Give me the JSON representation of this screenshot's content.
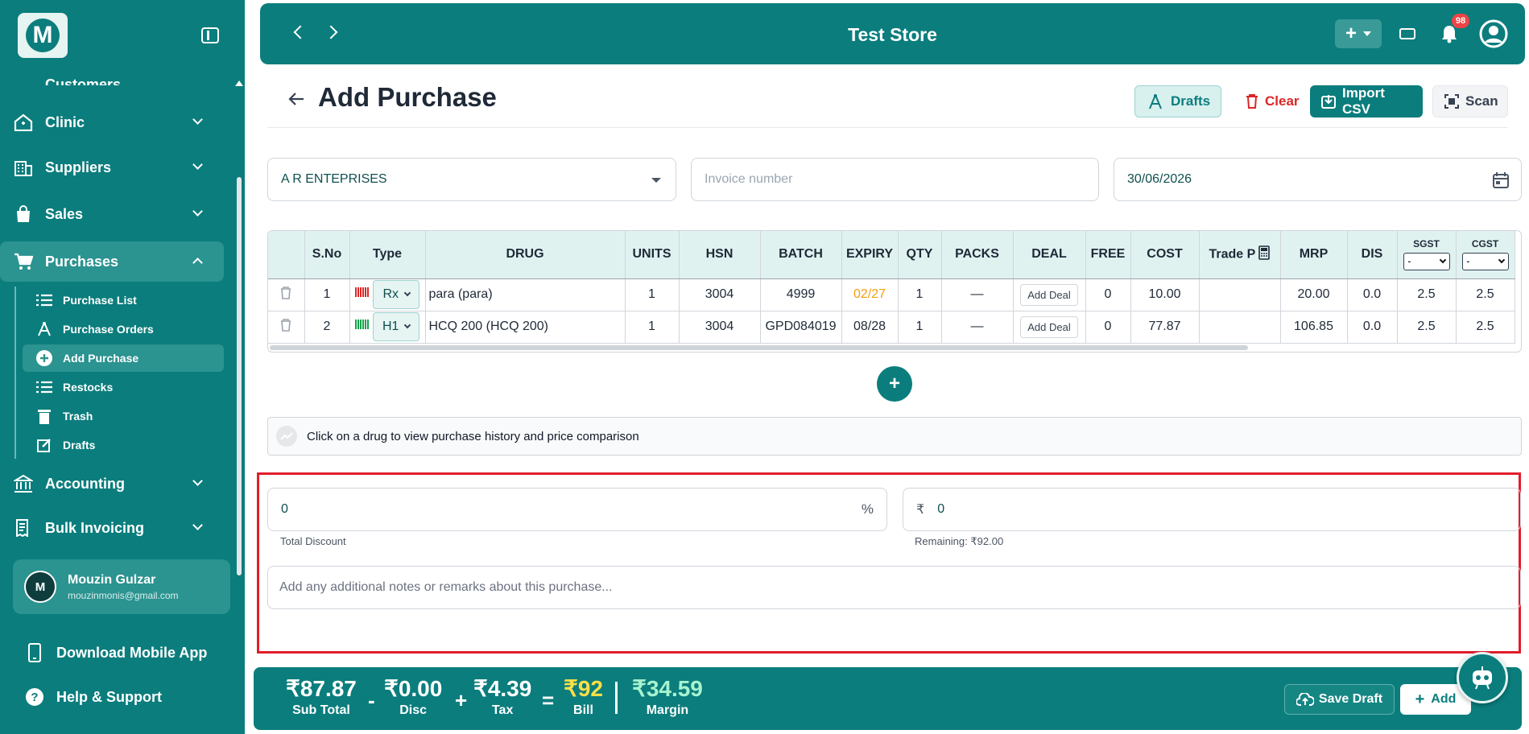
{
  "app": {
    "logo_letter": "M",
    "accent": "#0b7d7d"
  },
  "sidebar": {
    "partial_item": "Customers",
    "items": [
      {
        "label": "Clinic",
        "icon": "clinic-icon"
      },
      {
        "label": "Suppliers",
        "icon": "building-icon"
      },
      {
        "label": "Sales",
        "icon": "bag-icon"
      },
      {
        "label": "Purchases",
        "icon": "cart-icon"
      },
      {
        "label": "Accounting",
        "icon": "bank-icon"
      },
      {
        "label": "Bulk Invoicing",
        "icon": "receipt-icon"
      }
    ],
    "sub_items": [
      {
        "label": "Purchase List",
        "icon": "list-icon"
      },
      {
        "label": "Purchase Orders",
        "icon": "compass-icon"
      },
      {
        "label": "Add Purchase",
        "icon": "plus-circle-icon"
      },
      {
        "label": "Restocks",
        "icon": "list-icon"
      },
      {
        "label": "Trash",
        "icon": "trash-icon"
      },
      {
        "label": "Drafts",
        "icon": "edit-icon"
      }
    ],
    "user": {
      "initial": "M",
      "name": "Mouzin Gulzar",
      "email": "mouzinmonis@gmail.com"
    },
    "download_app": "Download Mobile App",
    "help": "Help & Support"
  },
  "topbar": {
    "title": "Test Store",
    "notification_count": "98"
  },
  "header": {
    "title": "Add Purchase",
    "drafts": "Drafts",
    "clear": "Clear",
    "import_csv": "Import CSV",
    "scan": "Scan"
  },
  "form": {
    "supplier": "A R ENTEPRISES",
    "invoice_placeholder": "Invoice number",
    "date": "30/06/2026"
  },
  "table": {
    "columns": [
      "S.No",
      "Type",
      "DRUG",
      "UNITS",
      "HSN",
      "BATCH",
      "EXPIRY",
      "QTY",
      "PACKS",
      "DEAL",
      "FREE",
      "COST",
      "Trade P",
      "MRP",
      "DIS",
      "SGST",
      "CGST"
    ],
    "tax_select_value": "-",
    "add_deal": "Add Deal",
    "rows": [
      {
        "sno": "1",
        "type": "Rx",
        "drug": "para (para)",
        "units": "1",
        "hsn": "3004",
        "batch": "4999",
        "expiry": "02/27",
        "qty": "1",
        "packs": "—",
        "free": "0",
        "cost": "10.00",
        "trade_p": "",
        "mrp": "20.00",
        "dis": "0.0",
        "sgst": "2.5",
        "cgst": "2.5"
      },
      {
        "sno": "2",
        "type": "H1",
        "drug": "HCQ 200 (HCQ 200)",
        "units": "1",
        "hsn": "3004",
        "batch": "GPD084019",
        "expiry": "08/28",
        "qty": "1",
        "packs": "—",
        "free": "0",
        "cost": "77.87",
        "trade_p": "",
        "mrp": "106.85",
        "dis": "0.0",
        "sgst": "2.5",
        "cgst": "2.5"
      }
    ]
  },
  "hint": "Click on a drug to view purchase history and price comparison",
  "discount": {
    "percent_value": "0",
    "percent_symbol": "%",
    "percent_label": "Total Discount",
    "currency_symbol": "₹",
    "amount_value": "0",
    "remaining": "Remaining: ₹92.00"
  },
  "notes_placeholder": "Add any additional notes or remarks about this purchase...",
  "footer": {
    "subtotal": "₹87.87",
    "subtotal_label": "Sub Total",
    "minus": "-",
    "disc": "₹0.00",
    "disc_label": "Disc",
    "plus": "+",
    "tax": "₹4.39",
    "tax_label": "Tax",
    "equals": "=",
    "bill": "₹92",
    "bill_label": "Bill",
    "margin": "₹34.59",
    "margin_label": "Margin",
    "save_draft": "Save Draft",
    "add": "Add"
  }
}
